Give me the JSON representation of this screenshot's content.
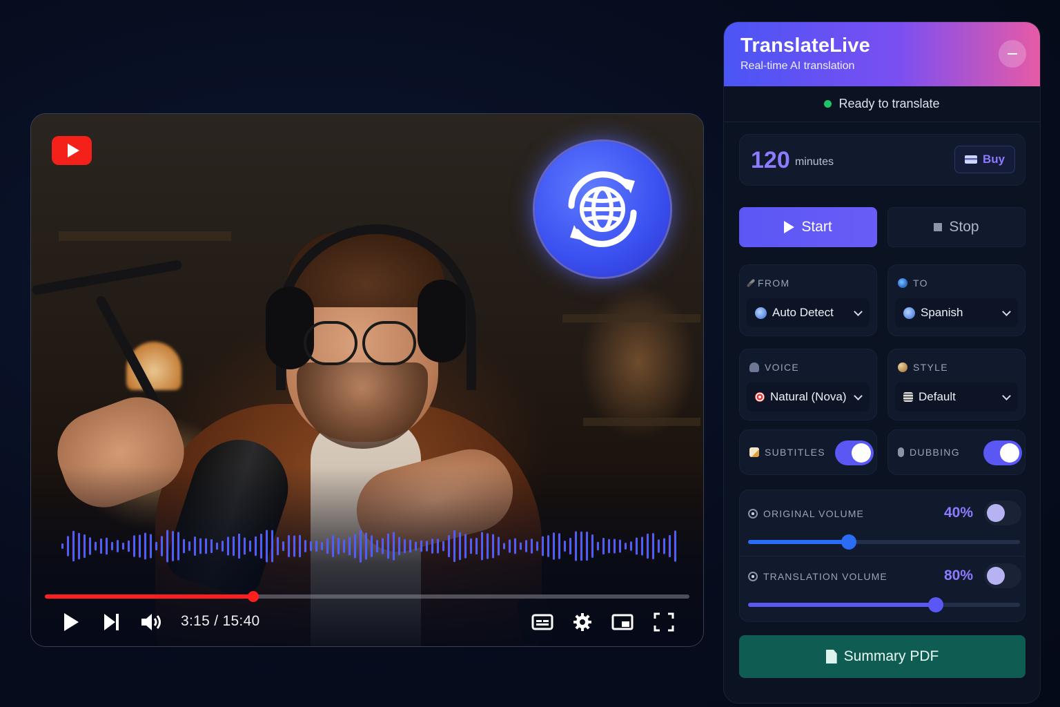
{
  "player": {
    "time_display": "3:15 / 15:40",
    "progress_fraction": 0.323,
    "icons": [
      "youtube-logo-icon",
      "translate-globe-icon",
      "play-icon",
      "next-icon",
      "volume-icon",
      "subtitles-icon",
      "settings-icon",
      "miniplayer-icon",
      "fullscreen-icon"
    ]
  },
  "panel": {
    "title": "TranslateLive",
    "subtitle": "Real-time AI translation",
    "status": "Ready to translate",
    "status_color": "#1ec46a",
    "minutes_value": "120",
    "minutes_label": "minutes",
    "buy_label": "Buy",
    "start_label": "Start",
    "stop_label": "Stop",
    "from_label": "FROM",
    "from_value": "Auto Detect",
    "to_label": "TO",
    "to_value": "Spanish",
    "voice_label": "VOICE",
    "voice_value": "Natural (Nova)",
    "style_label": "STYLE",
    "style_value": "Default",
    "subtitles_label": "SUBTITLES",
    "subtitles_on": true,
    "dubbing_label": "DUBBING",
    "dubbing_on": true,
    "original_volume_label": "ORIGINAL VOLUME",
    "original_volume_pct": "40%",
    "original_volume_value": 0.37,
    "translation_volume_label": "TRANSLATION VOLUME",
    "translation_volume_pct": "80%",
    "translation_volume_value": 0.69,
    "pdf_label": "Summary PDF"
  },
  "colors": {
    "accent": "#5b57f5",
    "accent_text": "#8c7bff",
    "youtube_red": "#f4211b",
    "pdf_green": "#0f5c52"
  }
}
